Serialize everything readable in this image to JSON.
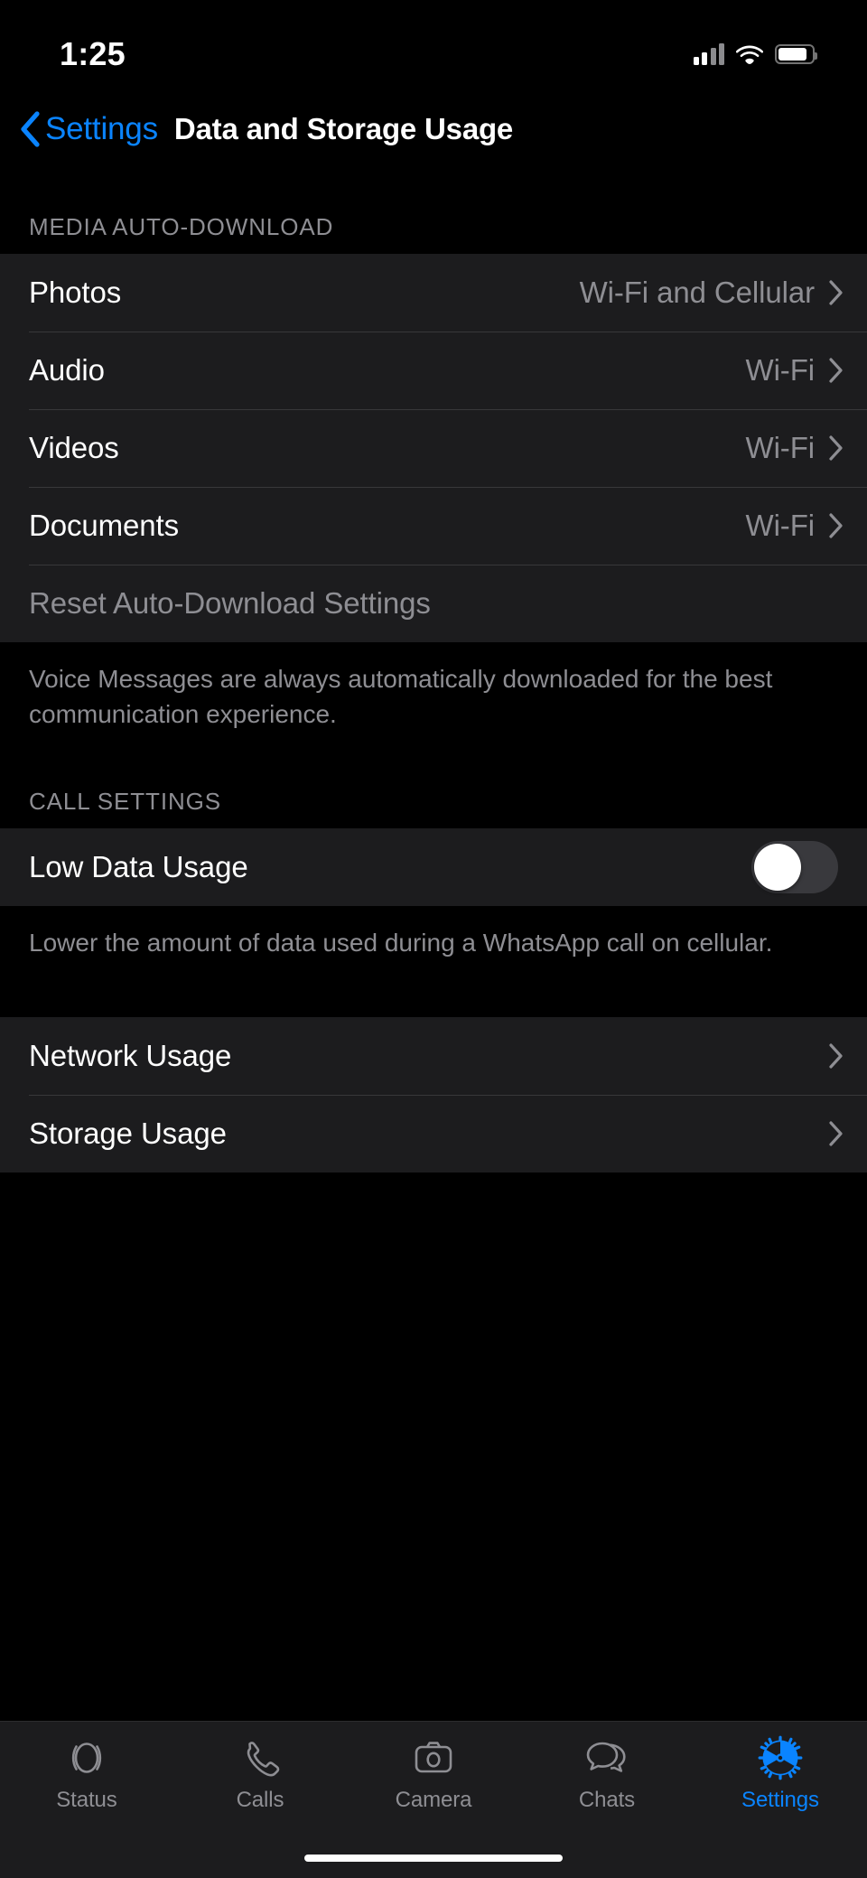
{
  "status_bar": {
    "time": "1:25",
    "signal_icon": "cellular-signal-icon",
    "wifi_icon": "wifi-icon",
    "battery_icon": "battery-icon"
  },
  "nav_bar": {
    "back_label": "Settings",
    "back_icon": "chevron-left-icon",
    "title": "Data and Storage Usage"
  },
  "sections": {
    "media_auto_download": {
      "header": "MEDIA AUTO-DOWNLOAD",
      "rows": [
        {
          "label": "Photos",
          "value": "Wi-Fi and Cellular",
          "chevron": true
        },
        {
          "label": "Audio",
          "value": "Wi-Fi",
          "chevron": true
        },
        {
          "label": "Videos",
          "value": "Wi-Fi",
          "chevron": true
        },
        {
          "label": "Documents",
          "value": "Wi-Fi",
          "chevron": true
        }
      ],
      "reset_label": "Reset Auto-Download Settings",
      "footnote": "Voice Messages are always automatically downloaded for the best communication experience."
    },
    "call_settings": {
      "header": "CALL SETTINGS",
      "toggle_label": "Low Data Usage",
      "toggle_state": "off",
      "footnote": "Lower the amount of data used during a WhatsApp call on cellular."
    },
    "usage": {
      "rows": [
        {
          "label": "Network Usage",
          "chevron": true
        },
        {
          "label": "Storage Usage",
          "chevron": true
        }
      ]
    }
  },
  "tab_bar": {
    "items": [
      {
        "label": "Status",
        "icon": "status-rings-icon",
        "active": false
      },
      {
        "label": "Calls",
        "icon": "phone-icon",
        "active": false
      },
      {
        "label": "Camera",
        "icon": "camera-icon",
        "active": false
      },
      {
        "label": "Chats",
        "icon": "chat-bubbles-icon",
        "active": false
      },
      {
        "label": "Settings",
        "icon": "gear-icon",
        "active": true
      }
    ]
  },
  "colors": {
    "accent": "#0a84ff",
    "background": "#000000",
    "group_background": "#1c1c1e",
    "separator": "#38383a",
    "secondary_text": "#8e8e93",
    "toggle_off_track": "#39393d"
  }
}
